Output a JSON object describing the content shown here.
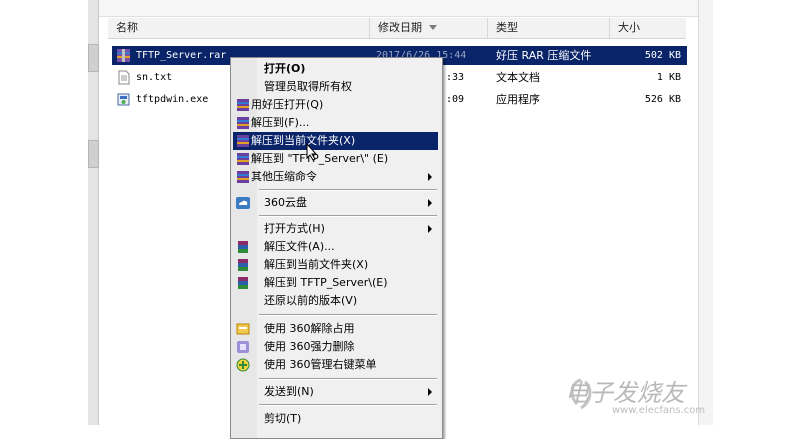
{
  "columns": [
    {
      "label": "名称"
    },
    {
      "label": "修改日期"
    },
    {
      "label": "类型"
    },
    {
      "label": "大小"
    }
  ],
  "files": [
    {
      "name": "TFTP_Server.rar",
      "date": "2017/6/26 15:44",
      "type": "好压 RAR 压缩文件",
      "size": "502 KB",
      "icon": "rar-archive-icon",
      "selected": true
    },
    {
      "name": "sn.txt",
      "date": ":33",
      "type": "文本文档",
      "size": "1 KB",
      "icon": "text-file-icon",
      "selected": false
    },
    {
      "name": "tftpdwin.exe",
      "date": ":09",
      "type": "应用程序",
      "size": "526 KB",
      "icon": "exe-icon",
      "selected": false
    }
  ],
  "context_menu": {
    "items": [
      {
        "label": "打开(O)",
        "bold": true
      },
      {
        "label": "管理员取得所有权"
      },
      {
        "label": "用好压打开(Q)",
        "icon": "haozip-icon"
      },
      {
        "label": "解压到(F)...",
        "icon": "haozip-icon"
      },
      {
        "label": "解压到当前文件夹(X)",
        "icon": "haozip-icon",
        "highlighted": true
      },
      {
        "label": "解压到 \"TFTP_Server\\\" (E)",
        "icon": "haozip-icon"
      },
      {
        "label": "其他压缩命令",
        "icon": "haozip-icon",
        "submenu": true
      },
      {
        "label": "360云盘",
        "icon": "cloud-icon",
        "submenu": true
      },
      {
        "label": "打开方式(H)",
        "submenu": true
      },
      {
        "label": "解压文件(A)...",
        "icon": "winrar-icon"
      },
      {
        "label": "解压到当前文件夹(X)",
        "icon": "winrar-icon"
      },
      {
        "label": "解压到 TFTP_Server\\(E)",
        "icon": "winrar-icon"
      },
      {
        "label": "还原以前的版本(V)"
      },
      {
        "label": "使用 360解除占用",
        "icon": "unlock-icon"
      },
      {
        "label": "使用 360强力删除",
        "icon": "delete-icon"
      },
      {
        "label": "使用 360管理右键菜单",
        "icon": "add-icon"
      },
      {
        "label": "发送到(N)",
        "submenu": true
      },
      {
        "label": "剪切(T)"
      }
    ]
  },
  "watermark": {
    "text": "电子发烧友",
    "sub": "www.elecfans.com"
  },
  "colors": {
    "selection": "#0a246a",
    "menu_bg": "#f0f0f0"
  }
}
